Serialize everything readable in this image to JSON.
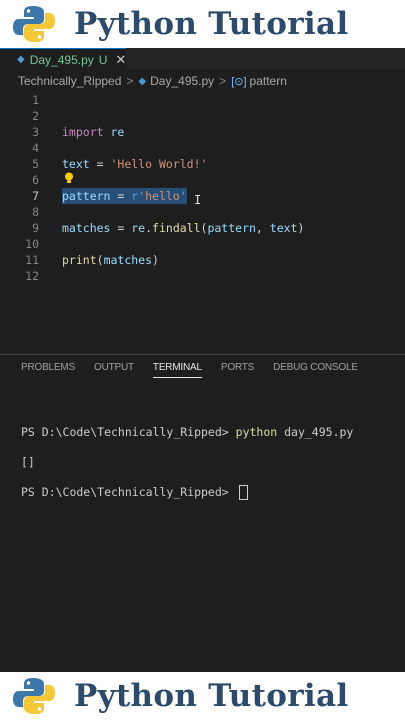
{
  "banner": {
    "title": "Python Tutorial"
  },
  "tab": {
    "filename": "Day_495.py",
    "status": "U",
    "close": "✕"
  },
  "breadcrumb": {
    "folder": "Technically_Ripped",
    "file": "Day_495.py",
    "symbol": "pattern",
    "sep": ">"
  },
  "editor": {
    "line_numbers": [
      "1",
      "2",
      "3",
      "4",
      "5",
      "6",
      "7",
      "8",
      "9",
      "10",
      "11",
      "12"
    ],
    "lines": {
      "l3_kw": "import",
      "l3_mod": " re",
      "l5_var": "text",
      "l5_op": " = ",
      "l5_str": "'Hello World!'",
      "l7_var": "pattern",
      "l7_op": " = ",
      "l7_prefix": "r",
      "l7_str": "'hello'",
      "l9_var": "matches",
      "l9_op": " = ",
      "l9_mod": "re",
      "l9_dot": ".",
      "l9_fn": "findall",
      "l9_open": "(",
      "l9_arg1": "pattern",
      "l9_comma": ", ",
      "l9_arg2": "text",
      "l9_close": ")",
      "l11_fn": "print",
      "l11_open": "(",
      "l11_arg": "matches",
      "l11_close": ")"
    },
    "cursor_glyph": "I"
  },
  "panel": {
    "tabs": [
      "PROBLEMS",
      "OUTPUT",
      "TERMINAL",
      "PORTS",
      "DEBUG CONSOLE"
    ],
    "active_tab": "TERMINAL"
  },
  "terminal": {
    "prompt": "PS D:\\Code\\Technically_Ripped> ",
    "command": "python",
    "args": " day_495.py",
    "output": "[]",
    "prompt2": "PS D:\\Code\\Technically_Ripped> "
  },
  "colors": {
    "banner_text": "#2e4a6b",
    "keyword": "#c586c0",
    "string": "#ce9178",
    "variable": "#9cdcfe",
    "function": "#dcdcaa",
    "selection": "#264f78"
  },
  "icons": {
    "logo": "python-logo-icon",
    "file": "python-file-icon",
    "symbol": "symbol-variable-icon",
    "lightbulb": "lightbulb-icon"
  }
}
